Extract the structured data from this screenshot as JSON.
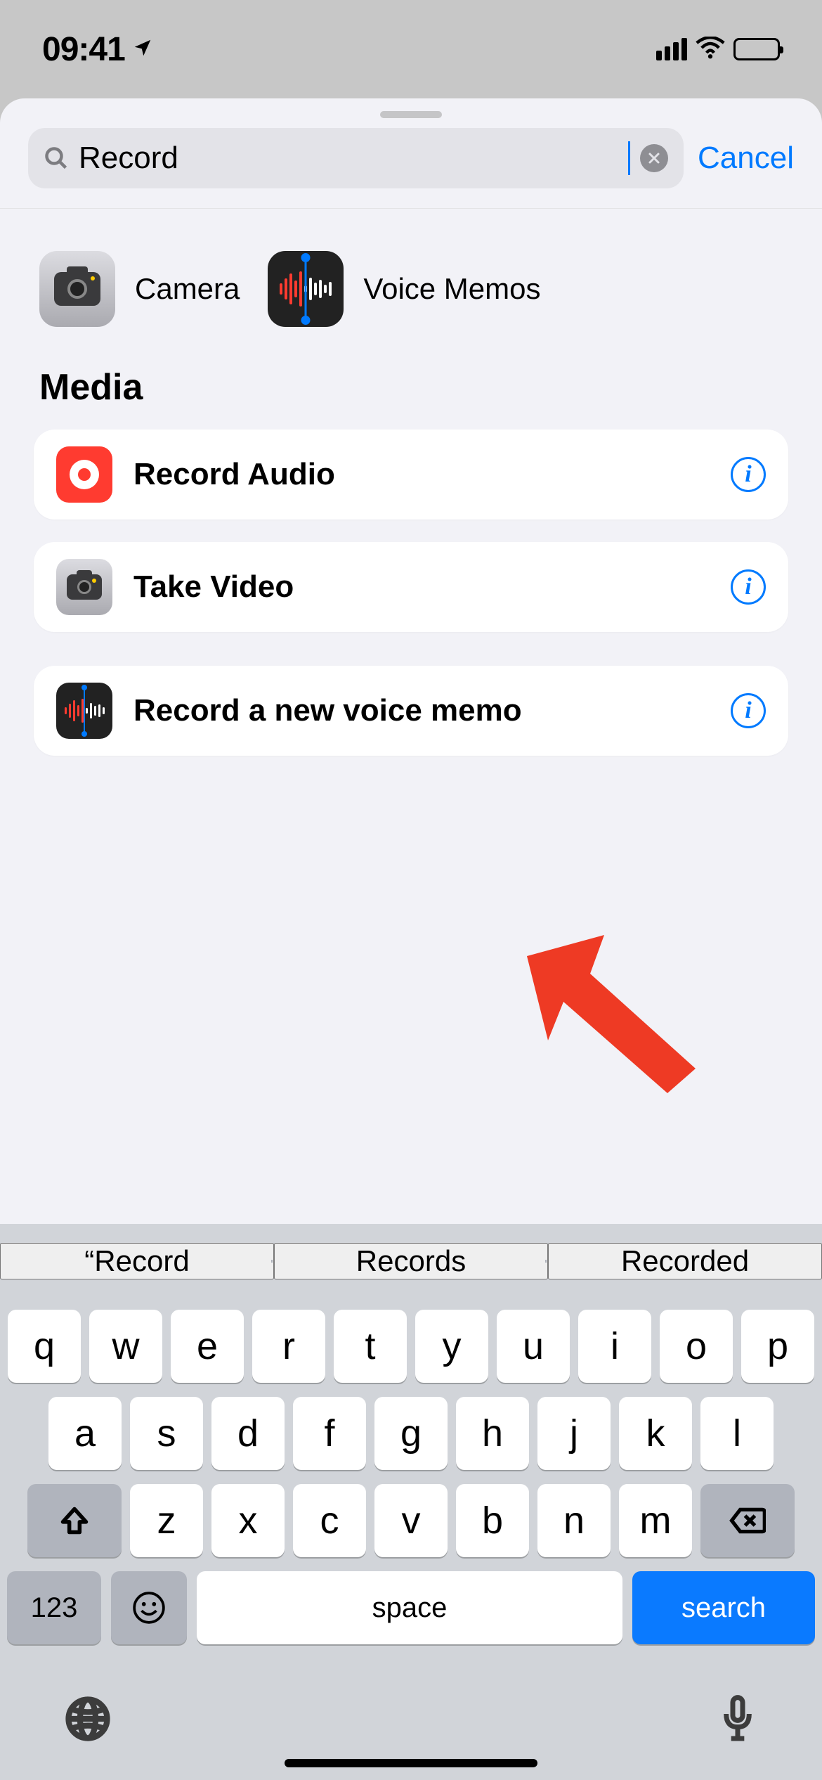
{
  "status": {
    "time": "09:41"
  },
  "search": {
    "value": "Record",
    "cancel": "Cancel"
  },
  "top_results": [
    {
      "name": "Camera"
    },
    {
      "name": "Voice Memos"
    }
  ],
  "section_title": "Media",
  "actions_primary": [
    {
      "label": "Record Audio",
      "icon": "record-audio"
    },
    {
      "label": "Take Video",
      "icon": "camera"
    }
  ],
  "actions_secondary": [
    {
      "label": "Record a new voice memo",
      "icon": "voice-memos"
    }
  ],
  "predictions": [
    "Record",
    "Records",
    "Recorded"
  ],
  "keyboard": {
    "row1": [
      "q",
      "w",
      "e",
      "r",
      "t",
      "y",
      "u",
      "i",
      "o",
      "p"
    ],
    "row2": [
      "a",
      "s",
      "d",
      "f",
      "g",
      "h",
      "j",
      "k",
      "l"
    ],
    "row3": [
      "z",
      "x",
      "c",
      "v",
      "b",
      "n",
      "m"
    ],
    "numkey": "123",
    "space": "space",
    "search": "search"
  }
}
